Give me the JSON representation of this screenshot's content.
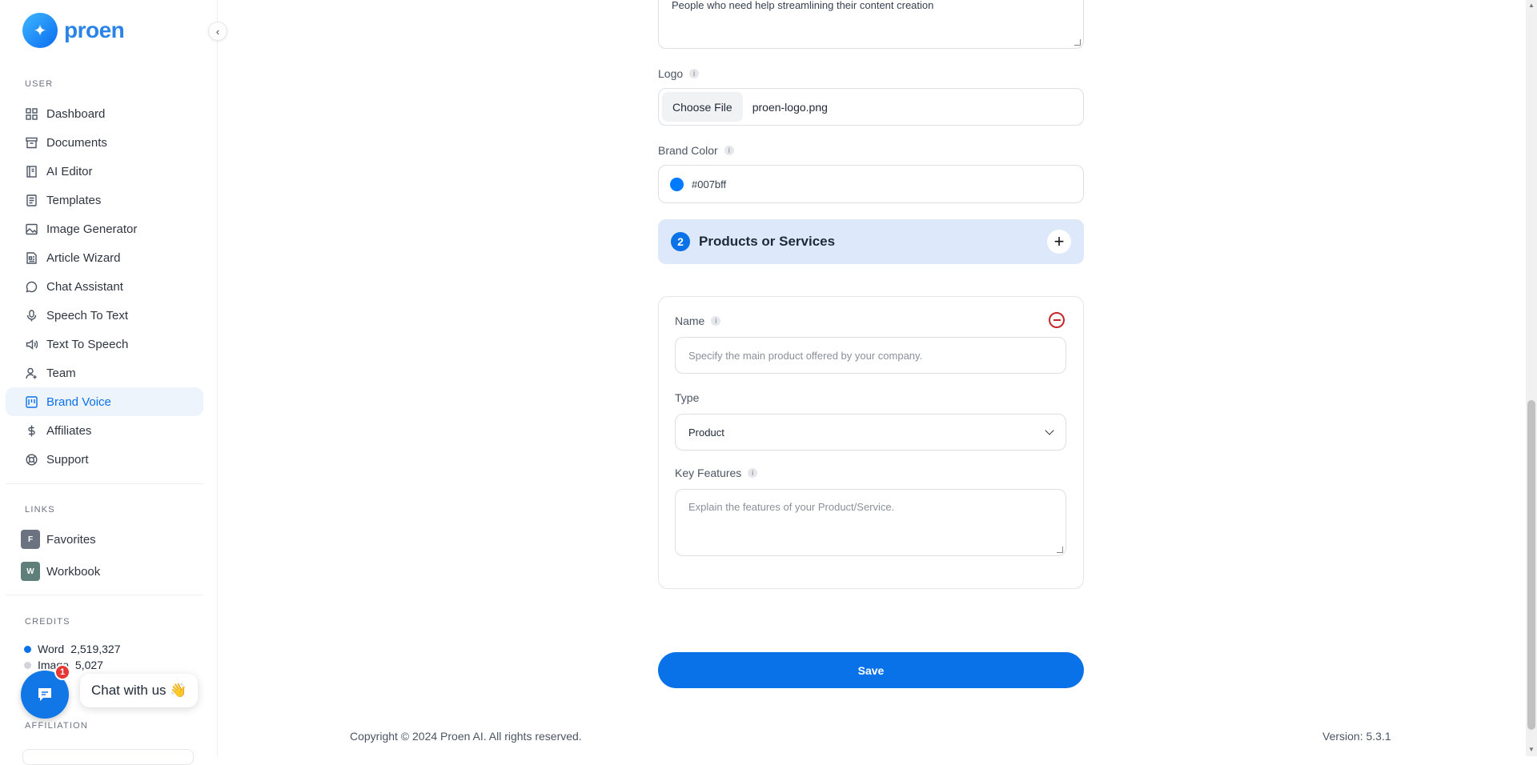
{
  "brand": {
    "name": "proen"
  },
  "sidebar": {
    "user_label": "USER",
    "items": [
      {
        "label": "Dashboard",
        "icon": "grid-icon"
      },
      {
        "label": "Documents",
        "icon": "archive-icon"
      },
      {
        "label": "AI Editor",
        "icon": "notebook-icon"
      },
      {
        "label": "Templates",
        "icon": "file-text-icon"
      },
      {
        "label": "Image Generator",
        "icon": "image-icon"
      },
      {
        "label": "Article Wizard",
        "icon": "article-icon"
      },
      {
        "label": "Chat Assistant",
        "icon": "chat-icon"
      },
      {
        "label": "Speech To Text",
        "icon": "microphone-icon"
      },
      {
        "label": "Text To Speech",
        "icon": "speaker-icon"
      },
      {
        "label": "Team",
        "icon": "user-plus-icon"
      },
      {
        "label": "Brand Voice",
        "icon": "layout-icon",
        "active": true
      },
      {
        "label": "Affiliates",
        "icon": "dollar-icon"
      },
      {
        "label": "Support",
        "icon": "lifebuoy-icon"
      }
    ],
    "links_label": "LINKS",
    "links": [
      {
        "badge": "F",
        "label": "Favorites",
        "color": "#6b7280"
      },
      {
        "badge": "W",
        "label": "Workbook",
        "color": "#5f7f7a"
      }
    ],
    "credits_label": "CREDITS",
    "credits": [
      {
        "label": "Word",
        "value": "2,519,327",
        "color": "#0a72e8"
      },
      {
        "label": "Image",
        "value": "5,027",
        "color": "#d1d5db"
      }
    ],
    "affiliation_label": "AFFILIATION"
  },
  "chat": {
    "badge": "1",
    "label": "Chat with us 👋"
  },
  "form": {
    "audience_value": "People who need help streamlining their content creation",
    "logo_label": "Logo",
    "choose_file": "Choose File",
    "file_name": "proen-logo.png",
    "brand_color_label": "Brand Color",
    "brand_color_value": "#007bff",
    "section_number": "2",
    "section_title": "Products or Services",
    "name_label": "Name",
    "name_placeholder": "Specify the main product offered by your company.",
    "type_label": "Type",
    "type_value": "Product",
    "features_label": "Key Features",
    "features_placeholder": "Explain the features of your Product/Service.",
    "save": "Save"
  },
  "footer": {
    "copyright": "Copyright © 2024 Proen AI. All rights reserved.",
    "version": "Version: 5.3.1"
  }
}
